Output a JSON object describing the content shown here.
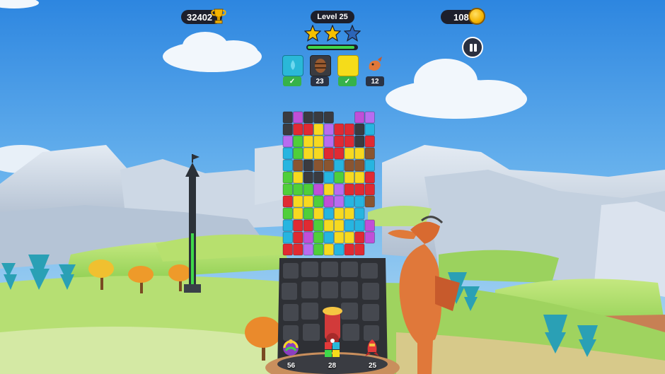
{
  "hud": {
    "score": "32402",
    "level": "Level 25",
    "coins": "108",
    "stars_earned": 2,
    "stars_total": 3,
    "progress": 0.95
  },
  "goals": [
    {
      "icon": "cyan-drop-block-icon",
      "status": "complete"
    },
    {
      "icon": "barrel-block-icon",
      "count": "23"
    },
    {
      "icon": "yellow-block-icon",
      "status": "complete"
    },
    {
      "icon": "dragon-icon",
      "count": "12"
    }
  ],
  "boosters": [
    {
      "icon": "rainbow-ball-booster-icon",
      "count": "56"
    },
    {
      "icon": "cube-bomb-booster-icon",
      "count": "28"
    },
    {
      "icon": "rocket-booster-icon",
      "count": "25"
    }
  ],
  "colors": {
    "sky": "#3b8fe0",
    "hud_dark": "#1d1f2b",
    "star_gold": "#f5c000",
    "star_empty": "#2c65b8",
    "progress_green": "#3fd84a"
  }
}
